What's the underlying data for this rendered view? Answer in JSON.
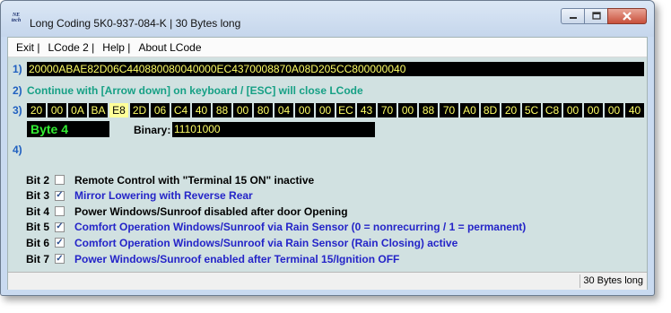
{
  "window": {
    "icon_text": [
      "NE",
      "tech"
    ],
    "title": "Long Coding  5K0-937-084-K | 30 Bytes long"
  },
  "menu": [
    "Exit |",
    "LCode 2 |",
    "Help |",
    "About LCode"
  ],
  "rows": {
    "r1": "1)",
    "r2": "2)",
    "r3": "3)",
    "r4": "4)"
  },
  "coding_hex": "20000ABAE82D06C440880080040000EC4370008870A08D205CC800000040",
  "instruction": "Continue with [Arrow down] on keyboard / [ESC] will close LCode",
  "bytes": [
    "20",
    "00",
    "0A",
    "BA",
    "E8",
    "2D",
    "06",
    "C4",
    "40",
    "88",
    "00",
    "80",
    "04",
    "00",
    "00",
    "EC",
    "43",
    "70",
    "00",
    "88",
    "70",
    "A0",
    "8D",
    "20",
    "5C",
    "C8",
    "00",
    "00",
    "00",
    "40"
  ],
  "selected_byte_index": 4,
  "byte_label": "Byte 4",
  "binary_label": "Binary:",
  "binary_value": "11101000",
  "bits": [
    {
      "name": "Bit 2",
      "checked": false,
      "desc": "Remote Control with \"Terminal 15 ON\" inactive"
    },
    {
      "name": "Bit 3",
      "checked": true,
      "desc": "Mirror Lowering with Reverse Rear"
    },
    {
      "name": "Bit 4",
      "checked": false,
      "desc": "Power Windows/Sunroof disabled after door Opening"
    },
    {
      "name": "Bit 5",
      "checked": true,
      "desc": "Comfort Operation Windows/Sunroof via Rain Sensor (0 = nonrecurring / 1 = permanent)"
    },
    {
      "name": "Bit 6",
      "checked": true,
      "desc": "Comfort Operation Windows/Sunroof via Rain Sensor (Rain Closing) active"
    },
    {
      "name": "Bit 7",
      "checked": true,
      "desc": "Power Windows/Sunroof enabled after Terminal 15/Ignition OFF"
    }
  ],
  "status": "30 Bytes long"
}
